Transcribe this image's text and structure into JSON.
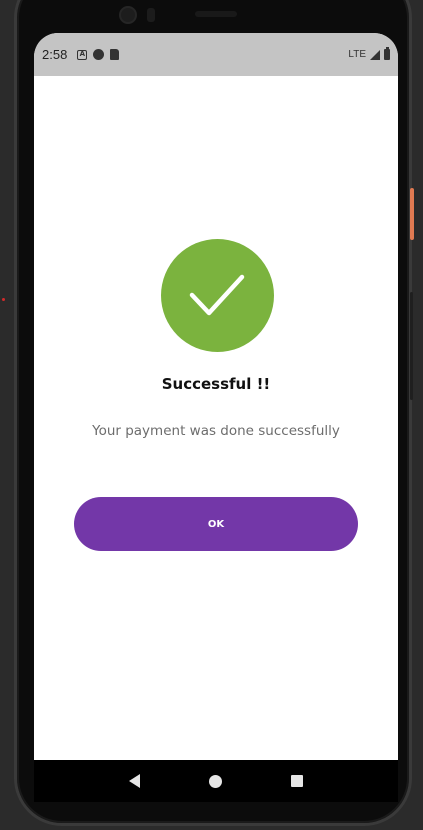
{
  "status_bar": {
    "time": "2:58",
    "network": "LTE",
    "icons": [
      "notification-a-icon",
      "notification-c-icon",
      "sd-card-icon",
      "signal-icon",
      "battery-icon"
    ]
  },
  "dialog": {
    "icon": "check-icon",
    "icon_color": "#7bb33e",
    "title": "Successful !!",
    "message": "Your payment was done successfully",
    "ok_label": "OK",
    "button_color": "#7337a8"
  },
  "nav_bar": {
    "buttons": [
      "back-icon",
      "home-icon",
      "recents-icon"
    ]
  }
}
